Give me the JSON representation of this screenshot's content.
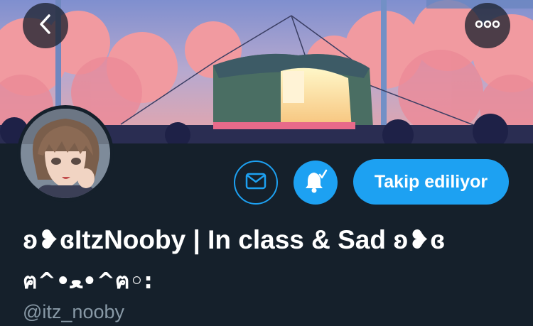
{
  "header": {
    "back_icon": "chevron-left-icon",
    "more_icon": "more-horizontal-icon"
  },
  "actions": {
    "message_icon": "envelope-icon",
    "notify_icon": "bell-check-icon",
    "follow_label": "Takip ediliyor"
  },
  "profile": {
    "display_name": "ʚ❥ɞItzNooby | In class & Sad ʚ❥ɞ",
    "display_name_line2": "ฅ^•ﻌ•^ฅ◦:",
    "handle": "@itz_nooby"
  },
  "colors": {
    "accent": "#1da1f2",
    "background": "#15202b",
    "secondary_text": "#8899a6"
  }
}
